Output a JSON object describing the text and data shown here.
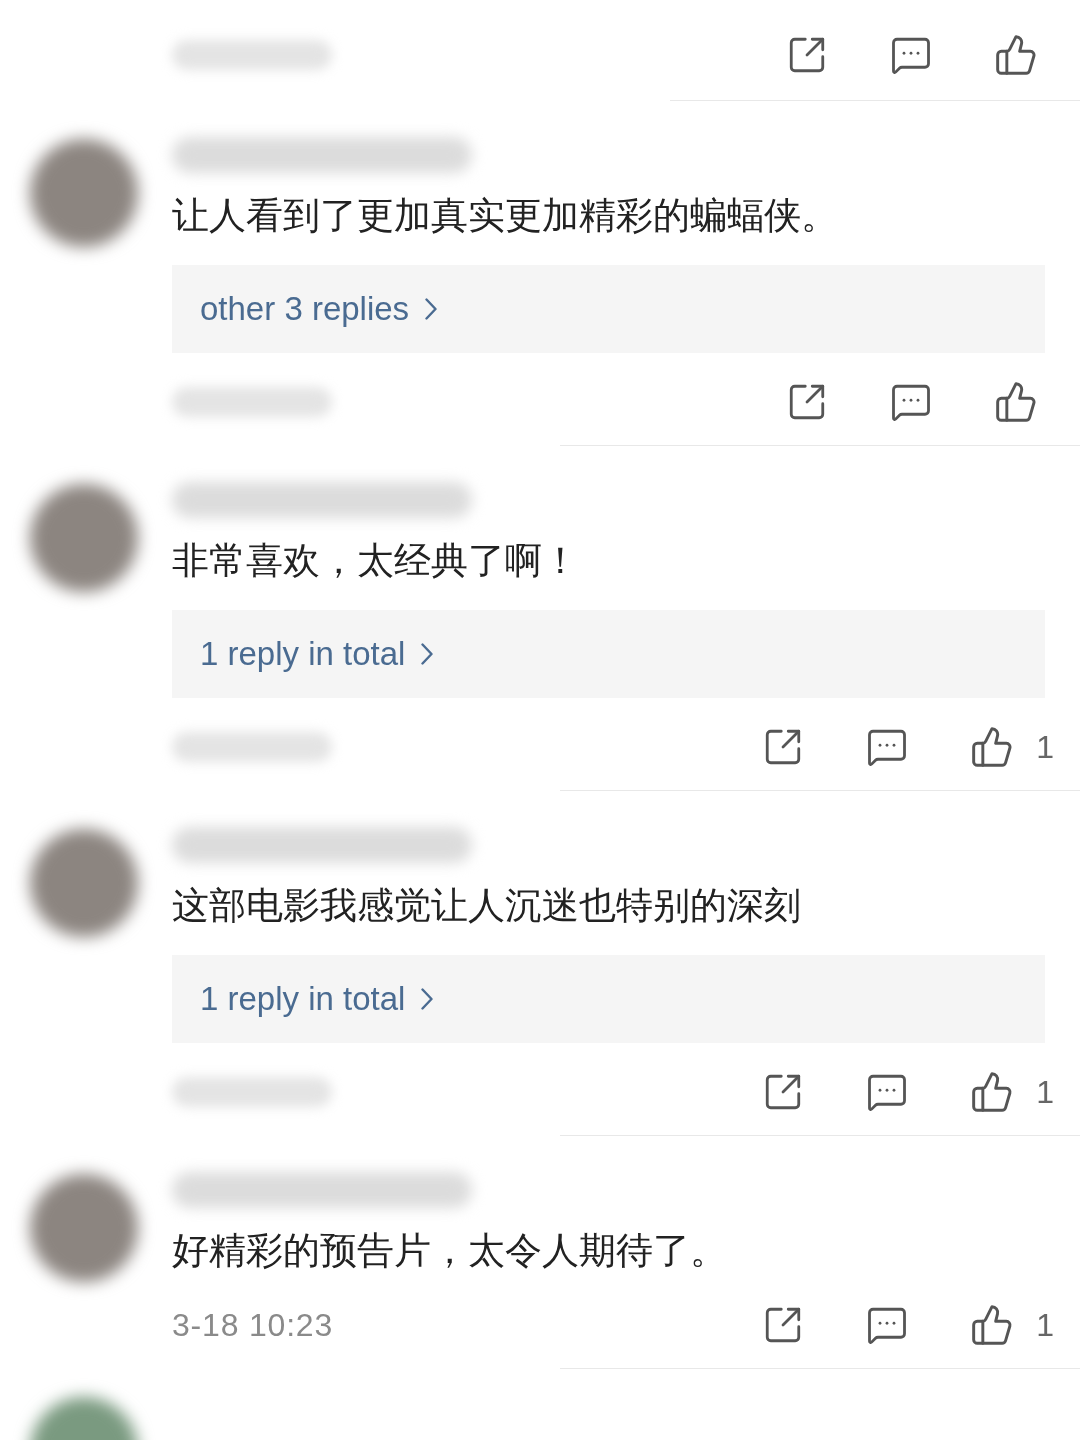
{
  "comments": [
    {
      "text": "让人看到了更加真实更加精彩的蝙蝠侠。",
      "replies_link": "other 3 replies"
    },
    {
      "text": "非常喜欢，太经典了啊！",
      "replies_link": "1 reply in total",
      "like_count": "1"
    },
    {
      "text": "这部电影我感觉让人沉迷也特别的深刻",
      "replies_link": "1 reply in total",
      "like_count": "1"
    },
    {
      "text": "好精彩的预告片，太令人期待了。",
      "date": "3-18 10:23",
      "like_count": "1"
    }
  ]
}
